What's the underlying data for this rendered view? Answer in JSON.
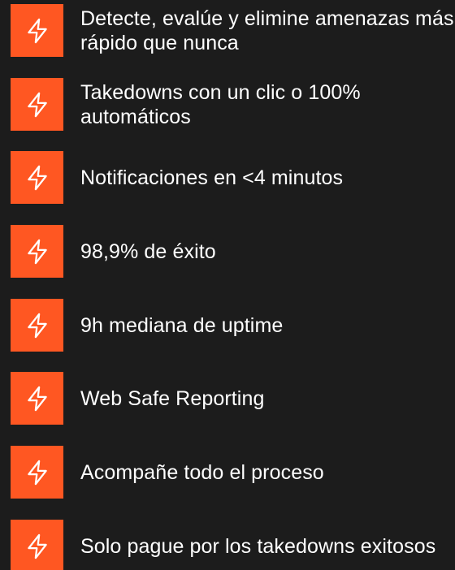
{
  "colors": {
    "background": "#1c1c1c",
    "accent": "#ff5722",
    "text": "#ffffff"
  },
  "features": [
    {
      "icon": "lightning-icon",
      "text": "Detecte, evalúe y elimine amenazas más rápido que nunca"
    },
    {
      "icon": "lightning-icon",
      "text": "Takedowns con un clic o 100% automáticos"
    },
    {
      "icon": "lightning-icon",
      "text": "Notificaciones en <4 minutos"
    },
    {
      "icon": "lightning-icon",
      "text": "98,9% de éxito"
    },
    {
      "icon": "lightning-icon",
      "text": "9h mediana de uptime"
    },
    {
      "icon": "lightning-icon",
      "text": "Web Safe Reporting"
    },
    {
      "icon": "lightning-icon",
      "text": "Acompañe todo el proceso"
    },
    {
      "icon": "lightning-icon",
      "text": "Solo pague por los takedowns exitosos"
    }
  ]
}
